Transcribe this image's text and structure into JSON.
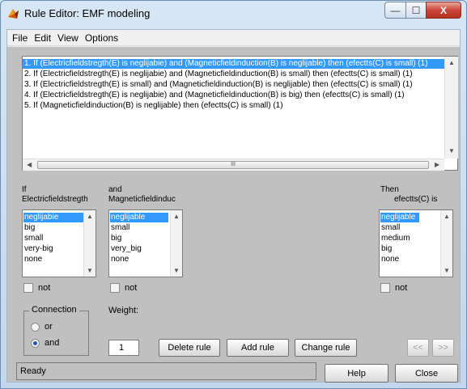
{
  "window": {
    "title": "Rule Editor: EMF modeling",
    "minimize_glyph": "—",
    "maximize_glyph": "☐",
    "close_glyph": "X"
  },
  "menu": [
    "File",
    "Edit",
    "View",
    "Options"
  ],
  "rules": [
    "1. If (Electricfieldstregth(E) is neglijabie) and (Magneticfieldinduction(B) is neglijable) then (efectts(C) is small) (1)",
    "2. If (Electricfieldstregth(E) is neglijabie) and (Magneticfieldinduction(B) is small) then (efectts(C) is small) (1)",
    "3. If (Electricfieldstregth(E) is small) and (Magneticfieldinduction(B) is neglijable) then (efectts(C) is small) (1)",
    "4. If (Electricfieldstregth(E) is neglijabie) and (Magneticfieldinduction(B) is big) then (efectts(C) is small) (1)",
    "5. If (Magneticfieldinduction(B) is neglijable) then (efectts(C) is small) (1)"
  ],
  "selected_rule_index": 0,
  "scroll": {
    "up": "▲",
    "down": "▼",
    "left": "◀",
    "right": "▶",
    "thumb_grip": "III"
  },
  "input1": {
    "label_top": "If",
    "label_name": "Electricfieldstregth",
    "options": [
      "neglijabie",
      "big",
      "small",
      "very-big",
      "none"
    ],
    "selected": "neglijabie",
    "not_label": "not"
  },
  "input2": {
    "label_top": "and",
    "label_name": "Magneticfieldinduc",
    "options": [
      "neglijable",
      "small",
      "big",
      "very_big",
      "none"
    ],
    "selected": "neglijable",
    "not_label": "not"
  },
  "output": {
    "label_top": "Then",
    "label_name": "efectts(C) is",
    "options": [
      "neglijable",
      "small",
      "medium",
      "big",
      "none"
    ],
    "selected": "neglijable",
    "not_label": "not"
  },
  "connection": {
    "title": "Connection",
    "options": [
      "or",
      "and"
    ],
    "selected": "and"
  },
  "weight": {
    "label": "Weight:",
    "value": "1"
  },
  "buttons": {
    "delete": "Delete rule",
    "add": "Add rule",
    "change": "Change rule",
    "prev": "<<",
    "next": ">>",
    "help": "Help",
    "close": "Close"
  },
  "status": "Ready",
  "colors": {
    "selection": "#3399ff",
    "panel": "#c0c0c0",
    "window_frame": "#cfe0f1"
  }
}
